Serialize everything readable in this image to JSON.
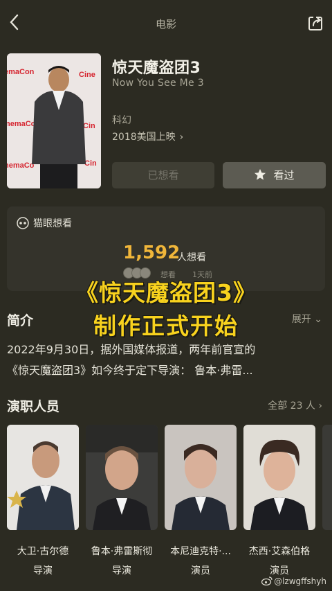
{
  "header": {
    "title": "电影",
    "back_icon": "chevron-left-icon",
    "share_icon": "share-icon"
  },
  "movie": {
    "title": "惊天魔盗团3",
    "english_title": "Now You See Me 3",
    "genre": "科幻",
    "release": "2018美国上映",
    "want_button": "已想看",
    "seen_button": "看过"
  },
  "maoyan": {
    "label": "猫眼想看",
    "count": "1,592",
    "count_label": "人想看",
    "recent_want": "想看",
    "recent_time": "1天前"
  },
  "overlay": {
    "line1": "《惊天魔盗团3》",
    "line2": "制作正式开始"
  },
  "summary": {
    "title": "简介",
    "expand": "展开",
    "line1": "2022年9月30日，据外国媒体报道，两年前官宣的",
    "line2": "《惊天魔盗团3》如今终于定下导演： 鲁本·弗雷..."
  },
  "cast": {
    "title": "演职人员",
    "all": "全部 23 人",
    "members": [
      {
        "name": "大卫·古尔德",
        "role": "导演"
      },
      {
        "name": "鲁本·弗雷斯彻",
        "role": "导演"
      },
      {
        "name": "本尼迪克特·...",
        "role": "演员"
      },
      {
        "name": "杰西·艾森伯格",
        "role": "演员"
      }
    ]
  },
  "watermark": "@lzwgffshyh",
  "colors": {
    "background": "#2c2b22",
    "accent": "#f0b63a",
    "overlay_text": "#f8d21e"
  }
}
